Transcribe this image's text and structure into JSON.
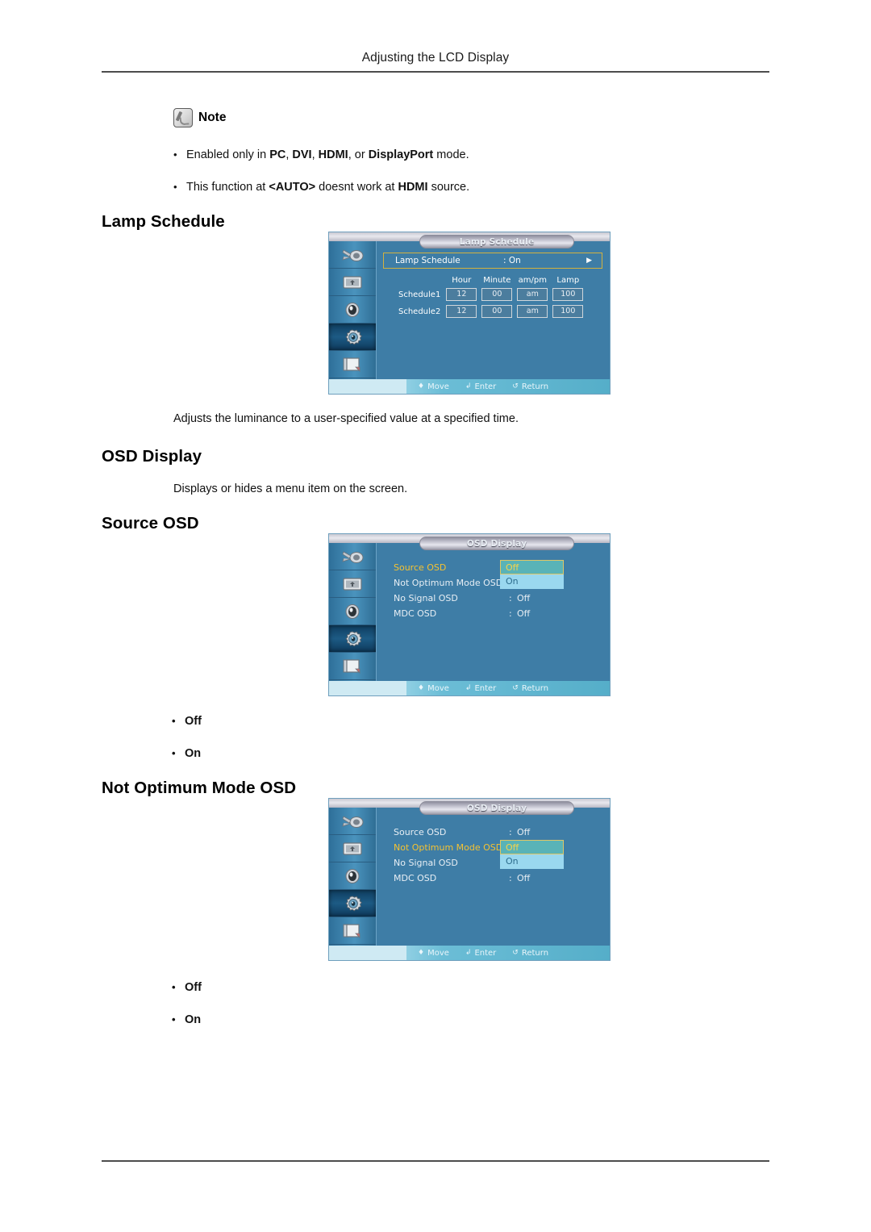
{
  "page": {
    "running_header": "Adjusting the LCD Display"
  },
  "note": {
    "icon": "note-pencil-icon",
    "label": "Note",
    "bullets": [
      {
        "bullet": "•",
        "segments": [
          {
            "text": "Enabled only in ",
            "bold": false
          },
          {
            "text": "PC",
            "bold": true
          },
          {
            "text": ", ",
            "bold": false
          },
          {
            "text": "DVI",
            "bold": true
          },
          {
            "text": ", ",
            "bold": false
          },
          {
            "text": "HDMI",
            "bold": true
          },
          {
            "text": ", or ",
            "bold": false
          },
          {
            "text": "DisplayPort",
            "bold": true
          },
          {
            "text": " mode.",
            "bold": false
          }
        ]
      },
      {
        "bullet": "•",
        "segments": [
          {
            "text": "This function at ",
            "bold": false
          },
          {
            "text": "<AUTO>",
            "bold": true
          },
          {
            "text": " doesnt work at ",
            "bold": false
          },
          {
            "text": "HDMI",
            "bold": true
          },
          {
            "text": " source.",
            "bold": false
          }
        ]
      }
    ]
  },
  "sections": {
    "lamp_schedule": {
      "heading": "Lamp Schedule",
      "description": "Adjusts the luminance to a user-specified value at a specified time."
    },
    "osd_display": {
      "heading": "OSD Display",
      "description": "Displays or hides a menu item on the screen."
    },
    "source_osd": {
      "heading": "Source OSD",
      "options": [
        {
          "bullet": "•",
          "label": "Off"
        },
        {
          "bullet": "•",
          "label": "On"
        }
      ]
    },
    "not_optimum_mode_osd": {
      "heading": "Not Optimum Mode OSD",
      "options": [
        {
          "bullet": "•",
          "label": "Off"
        },
        {
          "bullet": "•",
          "label": "On"
        }
      ]
    }
  },
  "osd_common": {
    "sidebar_icons": [
      "input-source-icon",
      "picture-icon",
      "sound-speaker-icon",
      "setup-gear-icon",
      "multi-control-icon"
    ],
    "footer": [
      {
        "glyph": "♦",
        "label": "Move"
      },
      {
        "glyph": "↲",
        "label": "Enter"
      },
      {
        "glyph": "↺",
        "label": "Return"
      }
    ],
    "colors": {
      "panel_bg": "#3e7da6",
      "sidebar": "#4a93bd",
      "highlight_border": "#d2b13f",
      "highlight_text": "#f4c232",
      "dropdown_selected_bg": "#59b3b7",
      "dropdown_selected_text": "#f6d34a",
      "dropdown_option_bg": "#9ad8ef",
      "footer_bg": "#cfeaf3"
    }
  },
  "osd_lamp_schedule": {
    "title": "Lamp Schedule",
    "selected_row": {
      "label": "Lamp Schedule",
      "colon_value": ": On",
      "arrow": "▶"
    },
    "table": {
      "columns": [
        "Hour",
        "Minute",
        "am/pm",
        "Lamp"
      ],
      "rows": [
        {
          "label": "Schedule1",
          "cells": [
            "12",
            "00",
            "am",
            "100"
          ]
        },
        {
          "label": "Schedule2",
          "cells": [
            "12",
            "00",
            "am",
            "100"
          ]
        }
      ]
    }
  },
  "osd_source": {
    "title": "OSD Display",
    "items": [
      {
        "name": "Source OSD",
        "colon": ":",
        "value": "Off",
        "highlight": true
      },
      {
        "name": "Not Optimum Mode OSD",
        "colon": ":",
        "value": "On",
        "highlight": false
      },
      {
        "name": "No Signal OSD",
        "colon": ":",
        "value": "Off",
        "highlight": false
      },
      {
        "name": "MDC OSD",
        "colon": ":",
        "value": "Off",
        "highlight": false
      }
    ],
    "dropdown": {
      "selected": "Off",
      "option": "On"
    }
  },
  "osd_not_optimum": {
    "title": "OSD Display",
    "items": [
      {
        "name": "Source OSD",
        "colon": ":",
        "value": "Off",
        "highlight": false
      },
      {
        "name": "Not Optimum Mode OSD",
        "colon": ":",
        "value": "Off",
        "highlight": true
      },
      {
        "name": "No Signal OSD",
        "colon": ":",
        "value": "On",
        "highlight": false
      },
      {
        "name": "MDC OSD",
        "colon": ":",
        "value": "Off",
        "highlight": false
      }
    ],
    "dropdown": {
      "selected": "Off",
      "option": "On"
    }
  }
}
